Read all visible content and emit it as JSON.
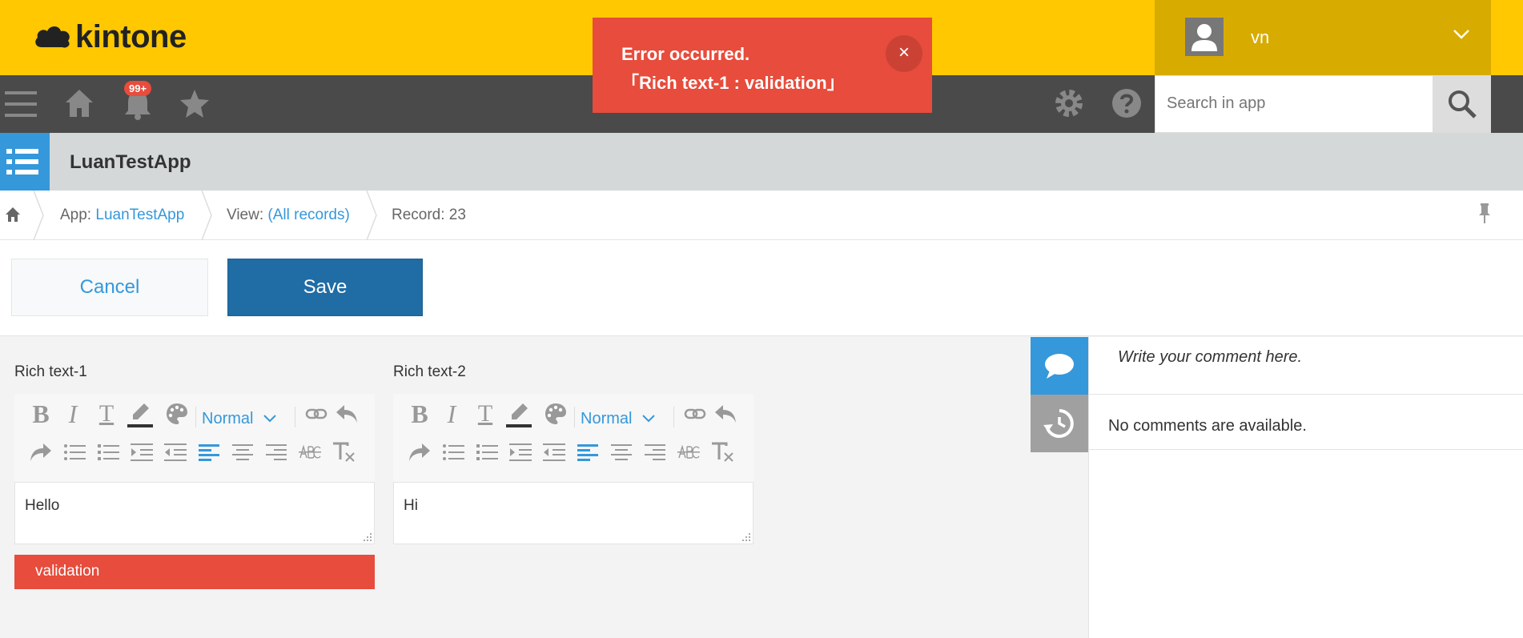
{
  "header": {
    "logo_text": "kintone",
    "notification_count": "99+",
    "username": "vn",
    "search_placeholder": "Search in app"
  },
  "error_toast": {
    "line1": "Error occurred.",
    "line2": "「Rich text-1 : validation」",
    "close_label": "×"
  },
  "app": {
    "title": "LuanTestApp"
  },
  "breadcrumb": {
    "app_prefix": "App: ",
    "app_link": "LuanTestApp",
    "view_prefix": "View: ",
    "view_link": "(All records)",
    "record": "Record: 23"
  },
  "actions": {
    "cancel_label": "Cancel",
    "save_label": "Save"
  },
  "fields": [
    {
      "label": "Rich text-1",
      "format": "Normal",
      "value": "Hello",
      "error": "validation"
    },
    {
      "label": "Rich text-2",
      "format": "Normal",
      "value": "Hi"
    }
  ],
  "comments": {
    "placeholder": "Write your comment here.",
    "empty_text": "No comments are available."
  },
  "colors": {
    "header_yellow": "#ffc800",
    "error_red": "#e74c3c",
    "save_blue": "#206ca5",
    "link_blue": "#3498db"
  }
}
